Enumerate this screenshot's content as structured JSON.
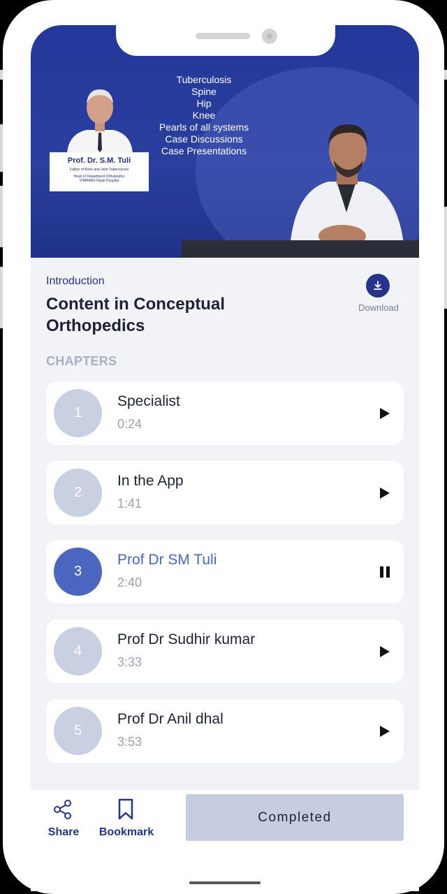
{
  "video": {
    "topics": [
      "Tuberculosis",
      "Spine",
      "Hip",
      "Knee",
      "Pearls of all systems",
      "Case Discussions",
      "Case Presentations"
    ],
    "name_card": {
      "name": "Prof. Dr. S.M. Tuli",
      "line1": "Father of Bone and Joint Tuberculosis",
      "line2": "Head of Department Orthopedics",
      "line3": "VIMHANS Niyati Hospital"
    }
  },
  "course": {
    "section_label": "Introduction",
    "title": "Content in Conceptual Orthopedics",
    "download_label": "Download"
  },
  "chapters_heading": "CHAPTERS",
  "chapters": [
    {
      "number": "1",
      "title": "Specialist",
      "duration": "0:24",
      "state": "play"
    },
    {
      "number": "2",
      "title": "In the App",
      "duration": "1:41",
      "state": "play"
    },
    {
      "number": "3",
      "title": "Prof Dr SM Tuli",
      "duration": "2:40",
      "state": "pause"
    },
    {
      "number": "4",
      "title": "Prof Dr Sudhir kumar",
      "duration": "3:33",
      "state": "play"
    },
    {
      "number": "5",
      "title": "Prof Dr Anil dhal",
      "duration": "3:53",
      "state": "play"
    }
  ],
  "bottom_bar": {
    "share_label": "Share",
    "bookmark_label": "Bookmark",
    "completed_label": "Completed"
  },
  "colors": {
    "primary": "#25348a",
    "active": "#4b66bf",
    "inactive_circle": "#c9d0e2",
    "completed_bg": "#c6cde0"
  },
  "icons": {
    "download": "download-icon",
    "play": "play-icon",
    "pause": "pause-icon",
    "share": "share-icon",
    "bookmark": "bookmark-icon"
  }
}
